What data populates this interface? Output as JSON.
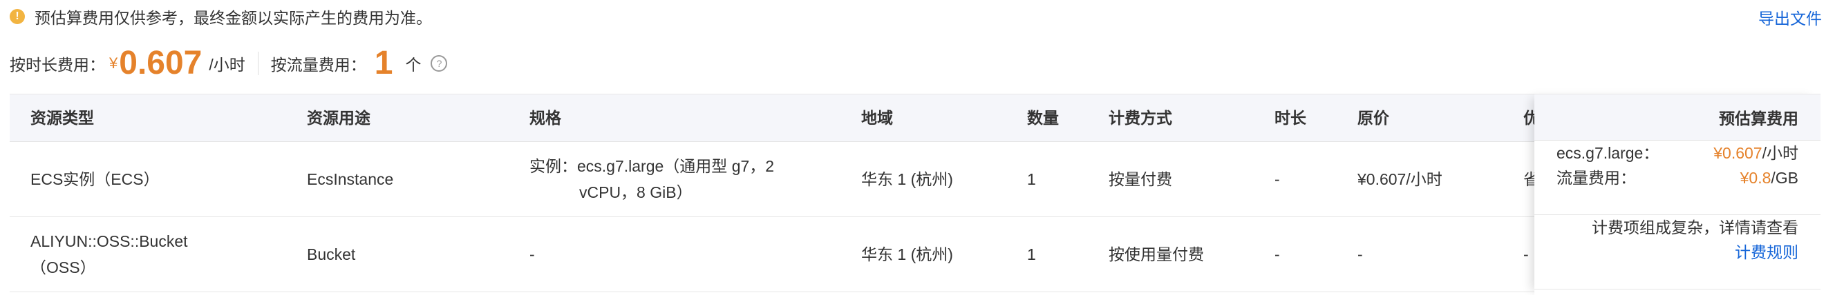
{
  "notice": {
    "text": "预估算费用仅供参考，最终金额以实际产生的费用为准。",
    "icon": "warning-icon"
  },
  "export_link": "导出文件",
  "summary": {
    "hourly_label": "按时长费用：",
    "hourly_currency": "¥",
    "hourly_value": "0.607",
    "hourly_unit": "/小时",
    "traffic_label": "按流量费用：",
    "traffic_value": "1",
    "traffic_unit": "个",
    "accent_color": "#e5822b"
  },
  "table": {
    "headers": [
      "资源类型",
      "资源用途",
      "规格",
      "地域",
      "数量",
      "计费方式",
      "时长",
      "原价",
      "优"
    ],
    "fixed_header": "预估算费用",
    "rows": [
      {
        "type": "ECS实例（ECS）",
        "usage": "EcsInstance",
        "spec_line1": "实例：ecs.g7.large（通用型 g7，2",
        "spec_line2": "vCPU，8 GiB）",
        "region": "华东 1 (杭州)",
        "qty": "1",
        "billing": "按量付费",
        "duration": "-",
        "price": "¥0.607/小时",
        "discount": "省"
      },
      {
        "type_line1": "ALIYUN::OSS::Bucket",
        "type_line2": "（OSS）",
        "usage": "Bucket",
        "spec": "-",
        "region": "华东 1 (杭州)",
        "qty": "1",
        "billing": "按使用量付费",
        "duration": "-",
        "price": "-",
        "discount": "-"
      }
    ],
    "fees": {
      "row1": [
        {
          "label": "ecs.g7.large：",
          "amount": "¥0.607",
          "unit": "/小时"
        },
        {
          "label": "流量费用：",
          "amount": "¥0.8",
          "unit": "/GB"
        }
      ],
      "row2_text": "计费项组成复杂，详情请查看",
      "row2_link": "计费规则"
    }
  }
}
